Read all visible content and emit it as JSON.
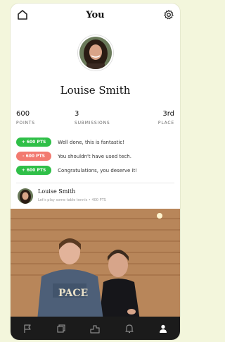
{
  "header": {
    "title": "You"
  },
  "profile": {
    "name": "Louise Smith"
  },
  "stats": {
    "points": {
      "value": "600",
      "label": "POINTS"
    },
    "submissions": {
      "value": "3",
      "label": "SUBMISSIONS"
    },
    "place": {
      "value": "3rd",
      "label": "PLACE"
    }
  },
  "activity": [
    {
      "badge": "+ 600 PTS",
      "text": "Well done, this is fantastic!",
      "color": "#2fbf48"
    },
    {
      "badge": "- 600 PTS",
      "text": "You shouldn't have used tech.",
      "color": "#f27a70"
    },
    {
      "badge": "+ 600 PTS",
      "text": "Congratulations, you deserve it!",
      "color": "#2fbf48"
    }
  ],
  "post": {
    "author": "Louise Smith",
    "subtitle": "Let's play some table tennis • 400 PTS"
  },
  "nav": {
    "items": [
      "flag-icon",
      "cards-icon",
      "leaderboard-icon",
      "bell-icon",
      "profile-icon"
    ],
    "active": "profile-icon"
  },
  "colors": {
    "accent_green": "#2fbf48",
    "accent_red": "#f27a70",
    "navbar": "#1b1b1b"
  }
}
